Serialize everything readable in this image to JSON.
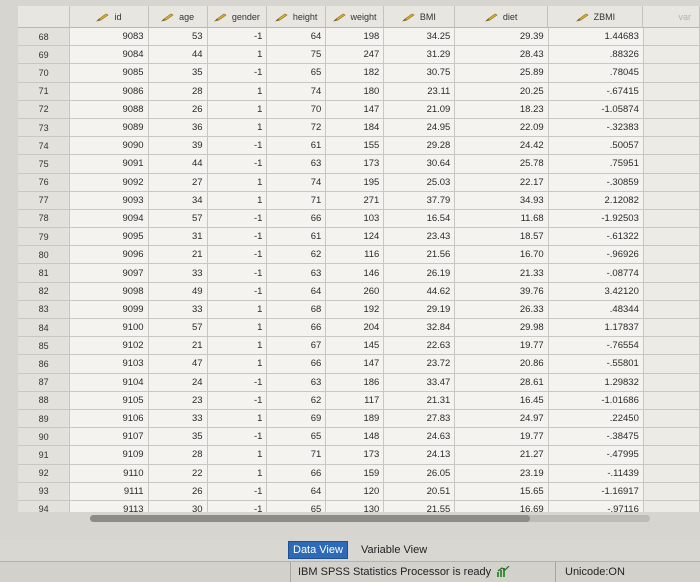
{
  "columns": [
    {
      "key": "id",
      "label": "id",
      "icon": "pencil-icon"
    },
    {
      "key": "age",
      "label": "age",
      "icon": "pencil-icon"
    },
    {
      "key": "gender",
      "label": "gender",
      "icon": "pencil-icon"
    },
    {
      "key": "height",
      "label": "height",
      "icon": "pencil-icon"
    },
    {
      "key": "weight",
      "label": "weight",
      "icon": "pencil-icon"
    },
    {
      "key": "bmi",
      "label": "BMI",
      "icon": "pencil-icon"
    },
    {
      "key": "diet",
      "label": "diet",
      "icon": "pencil-icon"
    },
    {
      "key": "zbmi",
      "label": "ZBMI",
      "icon": "pencil-icon"
    },
    {
      "key": "var",
      "label": "var",
      "icon": ""
    }
  ],
  "rows": [
    [
      "68",
      "9083",
      "53",
      "-1",
      "64",
      "198",
      "34.25",
      "29.39",
      "1.44683"
    ],
    [
      "69",
      "9084",
      "44",
      "1",
      "75",
      "247",
      "31.29",
      "28.43",
      ".88326"
    ],
    [
      "70",
      "9085",
      "35",
      "-1",
      "65",
      "182",
      "30.75",
      "25.89",
      ".78045"
    ],
    [
      "71",
      "9086",
      "28",
      "1",
      "74",
      "180",
      "23.11",
      "20.25",
      "-.67415"
    ],
    [
      "72",
      "9088",
      "26",
      "1",
      "70",
      "147",
      "21.09",
      "18.23",
      "-1.05874"
    ],
    [
      "73",
      "9089",
      "36",
      "1",
      "72",
      "184",
      "24.95",
      "22.09",
      "-.32383"
    ],
    [
      "74",
      "9090",
      "39",
      "-1",
      "61",
      "155",
      "29.28",
      "24.42",
      ".50057"
    ],
    [
      "75",
      "9091",
      "44",
      "-1",
      "63",
      "173",
      "30.64",
      "25.78",
      ".75951"
    ],
    [
      "76",
      "9092",
      "27",
      "1",
      "74",
      "195",
      "25.03",
      "22.17",
      "-.30859"
    ],
    [
      "77",
      "9093",
      "34",
      "1",
      "71",
      "271",
      "37.79",
      "34.93",
      "2.12082"
    ],
    [
      "78",
      "9094",
      "57",
      "-1",
      "66",
      "103",
      "16.54",
      "11.68",
      "-1.92503"
    ],
    [
      "79",
      "9095",
      "31",
      "-1",
      "61",
      "124",
      "23.43",
      "18.57",
      "-.61322"
    ],
    [
      "80",
      "9096",
      "21",
      "-1",
      "62",
      "116",
      "21.56",
      "16.70",
      "-.96926"
    ],
    [
      "81",
      "9097",
      "33",
      "-1",
      "63",
      "146",
      "26.19",
      "21.33",
      "-.08774"
    ],
    [
      "82",
      "9098",
      "49",
      "-1",
      "64",
      "260",
      "44.62",
      "39.76",
      "3.42120"
    ],
    [
      "83",
      "9099",
      "33",
      "1",
      "68",
      "192",
      "29.19",
      "26.33",
      ".48344"
    ],
    [
      "84",
      "9100",
      "57",
      "1",
      "66",
      "204",
      "32.84",
      "29.98",
      "1.17837"
    ],
    [
      "85",
      "9102",
      "21",
      "1",
      "67",
      "145",
      "22.63",
      "19.77",
      "-.76554"
    ],
    [
      "86",
      "9103",
      "47",
      "1",
      "66",
      "147",
      "23.72",
      "20.86",
      "-.55801"
    ],
    [
      "87",
      "9104",
      "24",
      "-1",
      "63",
      "186",
      "33.47",
      "28.61",
      "1.29832"
    ],
    [
      "88",
      "9105",
      "23",
      "-1",
      "62",
      "117",
      "21.31",
      "16.45",
      "-1.01686"
    ],
    [
      "89",
      "9106",
      "33",
      "1",
      "69",
      "189",
      "27.83",
      "24.97",
      ".22450"
    ],
    [
      "90",
      "9107",
      "35",
      "-1",
      "65",
      "148",
      "24.63",
      "19.77",
      "-.38475"
    ],
    [
      "91",
      "9109",
      "28",
      "1",
      "71",
      "173",
      "24.13",
      "21.27",
      "-.47995"
    ],
    [
      "92",
      "9110",
      "22",
      "1",
      "66",
      "159",
      "26.05",
      "23.19",
      "-.11439"
    ],
    [
      "93",
      "9111",
      "26",
      "-1",
      "64",
      "120",
      "20.51",
      "15.65",
      "-1.16917"
    ],
    [
      "94",
      "9113",
      "30",
      "-1",
      "65",
      "130",
      "21.55",
      "16.69",
      "-.97116"
    ]
  ],
  "tabs": {
    "data_view": "Data View",
    "variable_view": "Variable View"
  },
  "status": {
    "message": "IBM SPSS Statistics Processor is ready",
    "encoding": "Unicode:ON"
  }
}
